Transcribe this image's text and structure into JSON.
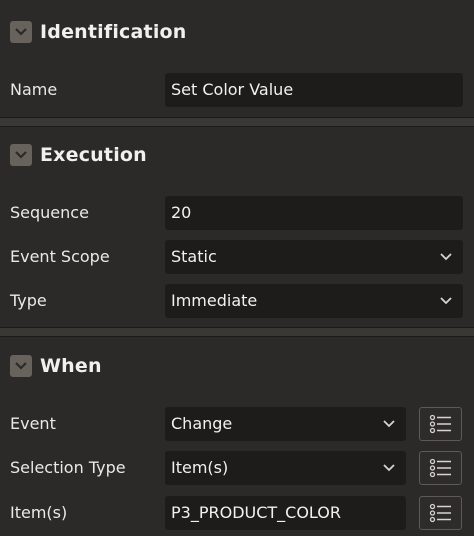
{
  "sections": {
    "identification": {
      "title": "Identification",
      "name_label": "Name",
      "name_value": "Set Color Value"
    },
    "execution": {
      "title": "Execution",
      "sequence_label": "Sequence",
      "sequence_value": "20",
      "event_scope_label": "Event Scope",
      "event_scope_value": "Static",
      "type_label": "Type",
      "type_value": "Immediate"
    },
    "when": {
      "title": "When",
      "event_label": "Event",
      "event_value": "Change",
      "selection_type_label": "Selection Type",
      "selection_type_value": "Item(s)",
      "items_label": "Item(s)",
      "items_value": "P3_PRODUCT_COLOR"
    }
  },
  "icons": {
    "collapse": "chevron-down-icon",
    "dropdown": "caret-down-icon",
    "list": "list-icon"
  },
  "colors": {
    "background": "#2b2a28",
    "field": "#1d1c1b",
    "text": "#efedea"
  }
}
